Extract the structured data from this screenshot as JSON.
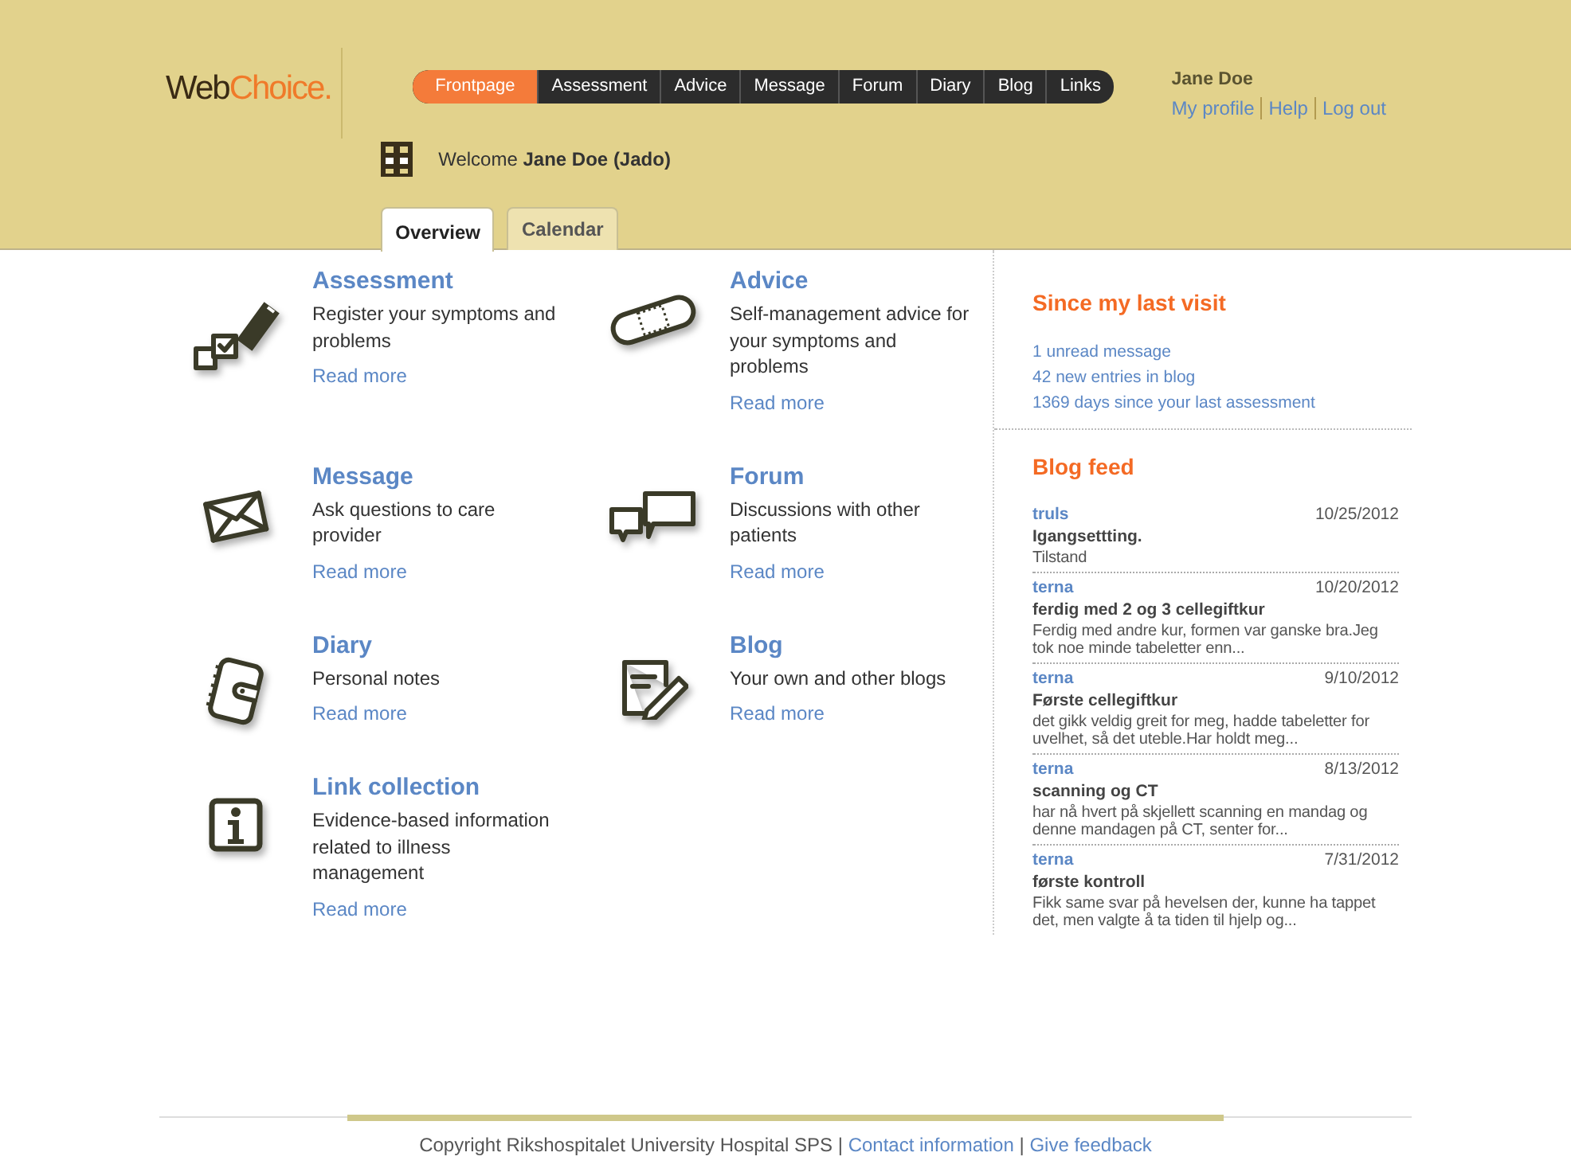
{
  "logo": {
    "part_1": "Web",
    "part_2": "Choice."
  },
  "nav": [
    {
      "label": "Frontpage",
      "selected": true
    },
    {
      "label": "Assessment",
      "selected": false
    },
    {
      "label": "Advice",
      "selected": false
    },
    {
      "label": "Message",
      "selected": false
    },
    {
      "label": "Forum",
      "selected": false
    },
    {
      "label": "Diary",
      "selected": false
    },
    {
      "label": "Blog",
      "selected": false
    },
    {
      "label": "Links",
      "selected": false
    }
  ],
  "user": {
    "name": "Jane Doe",
    "links": [
      "My profile",
      "Help",
      "Log out"
    ]
  },
  "welcome": "Welcome **Jane Doe (Jado)**",
  "tabs": [
    {
      "label": "Overview",
      "selected": true
    },
    {
      "label": "Calendar",
      "selected": false
    }
  ],
  "features": [
    {
      "title": "Assessment",
      "description": "Register your symptoms and problems",
      "link": "Read more"
    },
    {
      "title": "Advice",
      "description": "Self-management advice for your symptoms and problems",
      "link": "Read more"
    },
    {
      "title": "Message",
      "description": "Ask questions to care provider",
      "link": "Read more"
    },
    {
      "title": "Forum",
      "description": "Discussions with other patients",
      "link": "Read more"
    },
    {
      "title": "Diary",
      "description": "Personal notes",
      "link": "Read more"
    },
    {
      "title": "Blog",
      "description": "Your own and other blogs",
      "link": "Read more"
    },
    {
      "title": "Link collection",
      "description": "Evidence-based information related to illness management",
      "link": "Read more"
    }
  ],
  "since_last_visit": {
    "title": "Since my last visit",
    "items": [
      "1 unread message",
      "42 new entries in blog",
      "1369 days since your last assessment"
    ]
  },
  "blog_feed": {
    "title": "Blog feed",
    "entries": [
      {
        "author": "truls",
        "date": "10/25/2012",
        "title": "Igangsettting.",
        "excerpt": "Tilstand"
      },
      {
        "author": "terna",
        "date": "10/20/2012",
        "title": "ferdig med 2 og 3 cellegiftkur",
        "excerpt": "Ferdig med andre kur, formen var ganske bra.Jeg tok noe minde tabeletter enn..."
      },
      {
        "author": "terna",
        "date": "9/10/2012",
        "title": "Første cellegiftkur",
        "excerpt": "det gikk veldig greit for meg, hadde tabeletter for uvelhet, så det uteble.Har holdt meg..."
      },
      {
        "author": "terna",
        "date": "8/13/2012",
        "title": "scanning og CT",
        "excerpt": "har nå hvert på skjellett scanning en mandag og denne mandagen på CT, senter for..."
      },
      {
        "author": "terna",
        "date": "7/31/2012",
        "title": "første kontroll",
        "excerpt": "Fikk same svar på hevelsen der, kunne ha tappet det, men valgte å ta tiden til hjelp og..."
      }
    ]
  },
  "footer": {
    "copyright": "Copyright Rikshospitalet University Hospital SPS",
    "separator": "|",
    "links": [
      "Contact information",
      "Give feedback"
    ]
  }
}
